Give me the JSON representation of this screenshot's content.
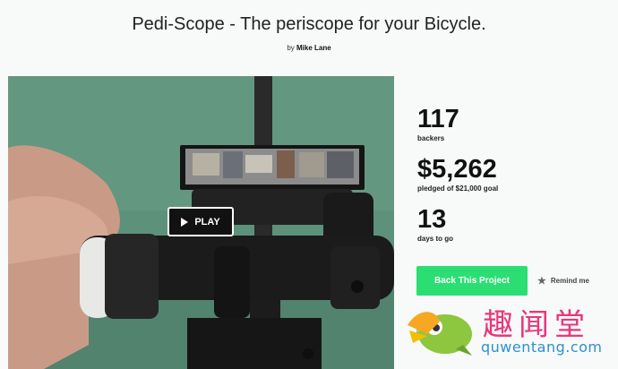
{
  "header": {
    "title": "Pedi-Scope - The periscope for your Bicycle.",
    "by_prefix": "by",
    "author": "Mike Lane"
  },
  "video": {
    "play_label": "PLAY"
  },
  "stats": {
    "backers_count": "117",
    "backers_label": "backers",
    "pledged_amount": "$5,262",
    "pledged_label": "pledged of $21,000 goal",
    "days_count": "13",
    "days_label": "days to go"
  },
  "actions": {
    "back_label": "Back This Project",
    "remind_label": "Remind me",
    "remind_icon": "star-icon",
    "accent_color": "#2bde73"
  },
  "watermark": {
    "cn": "趣闻堂",
    "en": "quwentang.com"
  },
  "partial": {
    "text": "pr"
  }
}
